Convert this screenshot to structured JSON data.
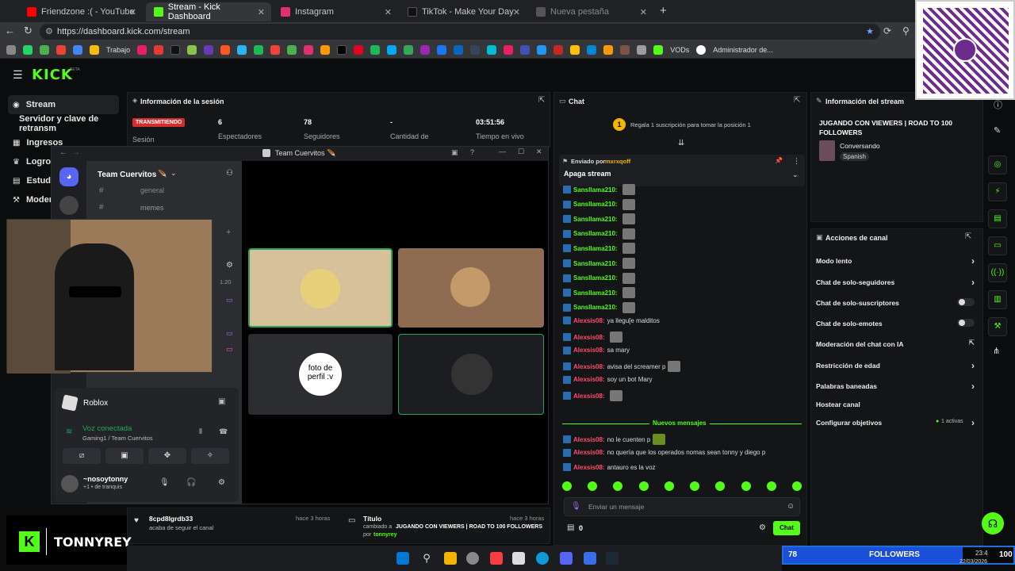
{
  "browser": {
    "tabs": [
      {
        "label": "Friendzone :( - YouTube",
        "color": "#ff0000"
      },
      {
        "label": "Stream - Kick Dashboard",
        "color": "#53fc18"
      },
      {
        "label": "Instagram",
        "color": "#e1306c"
      },
      {
        "label": "TikTok - Make Your Day",
        "color": "#111111"
      },
      {
        "label": "Nueva pestaña",
        "color": "#777777"
      }
    ],
    "url": "https://dashboard.kick.com/stream",
    "bookmarks": {
      "trabajo": "Trabajo",
      "vods": "VODs",
      "admin": "Administrador de..."
    }
  },
  "kick": {
    "logo": "KICK",
    "logo_beta": "BETA",
    "nav": {
      "stream": "Stream",
      "server": "Servidor y clave de retransm",
      "ingresos": "Ingresos",
      "logros": "Logros",
      "estudio": "Estudi",
      "moder": "Moder"
    },
    "session": {
      "title": "Información de la sesión",
      "status": "TRANSMITIENDO",
      "session_label": "Sesión",
      "viewers_value": "6",
      "viewers_label": "Espectadores",
      "followers_value": "78",
      "followers_label": "Seguidores",
      "amount_value": "-",
      "amount_label": "Cantidad de",
      "time_value": "03:51:56",
      "time_label": "Tiempo en vivo"
    },
    "chat": {
      "title": "Chat",
      "gift_text": "Regala 1 suscripción para tomar la posición 1",
      "gift_badge": "1",
      "pinned_by_label": "Enviado por",
      "pinned_by_user": "mxrxqoff",
      "pinned_message": "Apaga stream",
      "lines": [
        {
          "user": "Sansllama210:",
          "text": "",
          "color": "green",
          "emote": true
        },
        {
          "user": "Sansllama210:",
          "text": "",
          "color": "green",
          "emote": true
        },
        {
          "user": "Sansllama210:",
          "text": "",
          "color": "green",
          "emote": true
        },
        {
          "user": "Sansllama210:",
          "text": "",
          "color": "green",
          "emote": true
        },
        {
          "user": "Sansllama210:",
          "text": "",
          "color": "green",
          "emote": true
        },
        {
          "user": "Sansllama210:",
          "text": "",
          "color": "green",
          "emote": true
        },
        {
          "user": "Sansllama210:",
          "text": "",
          "color": "green",
          "emote": true
        },
        {
          "user": "Sansllama210:",
          "text": "",
          "color": "green",
          "emote": true
        },
        {
          "user": "Sansllama210:",
          "text": "",
          "color": "green",
          "emote": true
        },
        {
          "user": "Alexsis08:",
          "text": "ya llegu[e malditos",
          "color": "red",
          "emote": false
        },
        {
          "user": "Alexsis08:",
          "text": "",
          "color": "red",
          "emote": true
        },
        {
          "user": "Alexsis08:",
          "text": "sa mary",
          "color": "red",
          "emote": false
        },
        {
          "user": "Alexsis08:",
          "text": "avisa del screamer p",
          "color": "red",
          "emote": true
        },
        {
          "user": "Alexsis08:",
          "text": "soy un bot Mary",
          "color": "red",
          "emote": false
        },
        {
          "user": "Alexsis08:",
          "text": "",
          "color": "red",
          "emote": true
        }
      ],
      "new_messages": "Nuevos mensajes",
      "lines_new": [
        {
          "user": "Alexsis08:",
          "text": "no le cuenten p",
          "emote": true
        },
        {
          "user": "Alexsis08:",
          "text": "no quería que los operados nomas sean tonny y diego p",
          "emote": false
        },
        {
          "user": "Alexsis08:",
          "text": "antauro es la voz",
          "emote": false
        }
      ],
      "input_placeholder": "Enviar un mensaje",
      "points": "0",
      "send_label": "Chat"
    },
    "stream_info": {
      "title": "Información del stream",
      "stream_title": "JUGANDO CON VIEWERS | ROAD TO 100 FOLLOWERS",
      "category": "Conversando",
      "language": "Spanish"
    },
    "actions": {
      "title": "Acciones de canal",
      "items": [
        {
          "label": "Modo lento",
          "kind": "chevron"
        },
        {
          "label": "Chat de solo-seguidores",
          "kind": "chevron"
        },
        {
          "label": "Chat de solo-suscriptores",
          "kind": "toggle"
        },
        {
          "label": "Chat de solo-emotes",
          "kind": "toggle"
        },
        {
          "label": "Moderación del chat con IA",
          "kind": "external"
        },
        {
          "label": "Restricción de edad",
          "kind": "chevron"
        },
        {
          "label": "Palabras baneadas",
          "kind": "chevron"
        },
        {
          "label": "Hostear canal",
          "kind": "none"
        },
        {
          "label": "Configurar objetivos",
          "kind": "chevron"
        }
      ],
      "active_goals": "1 activas"
    },
    "activity": {
      "follow_user": "8cpd8lgrdb33",
      "follow_text": "acaba de seguir el canal",
      "follow_time": "hace 3 horas",
      "title_label": "Título",
      "title_time": "hace 3 horas",
      "title_changed": "cambiado a",
      "title_value": "JUGANDO CON VIEWERS | ROAD TO 100 FOLLOWERS",
      "title_by": "por",
      "title_user": "tonnyrey"
    }
  },
  "discord": {
    "window_title": "Team Cuervitos 🪶",
    "server_name": "Team Cuervitos",
    "channels": [
      "general",
      "memes"
    ],
    "game": "Roblox",
    "voice_status": "Voz conectada",
    "voice_channel": "Gaming1 / Team Cuervitos",
    "username": "~nosoytonny",
    "user_status": "+1 • de tranquis",
    "time_partial": "1:20",
    "tile3_text": "foto de perfil :v"
  },
  "overlay": {
    "streamer_name": "TONNYREY",
    "follower_count": "78",
    "follower_label": "FOLLOWERS",
    "follower_goal": "100",
    "follower_progress": 0.78,
    "clock_time": "23:4",
    "clock_date": "22/03/2026"
  }
}
